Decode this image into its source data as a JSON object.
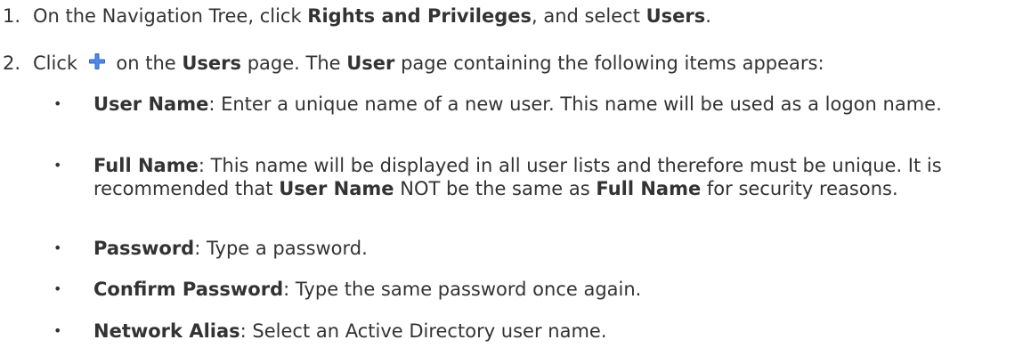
{
  "steps": [
    {
      "num": "1.",
      "parts": [
        "On the Navigation Tree, click ",
        "Rights and Privileges",
        ", and select ",
        "Users",
        "."
      ]
    },
    {
      "num": "2.",
      "parts": [
        "Click ",
        " on the ",
        "Users",
        " page. The ",
        "User",
        " page containing the following items appears:"
      ],
      "icon": "plus-icon",
      "icon_color": "#2a64c8"
    }
  ],
  "items": [
    {
      "term": "User Name",
      "desc": ": Enter a unique name of a new user. This name will be used as a logon name."
    },
    {
      "term": "Full Name",
      "desc_parts": [
        ": This name will be displayed in all user lists and therefore must be unique. It is recommended that ",
        "User Name",
        " NOT be the same as ",
        "Full Name",
        " for security reasons."
      ]
    },
    {
      "term": "Password",
      "desc": ": Type a password."
    },
    {
      "term": "Confirm Password",
      "desc": ": Type the same password once again."
    },
    {
      "term": "Network Alias",
      "desc": ": Select an Active Directory user name."
    }
  ],
  "bullet_char": "•"
}
